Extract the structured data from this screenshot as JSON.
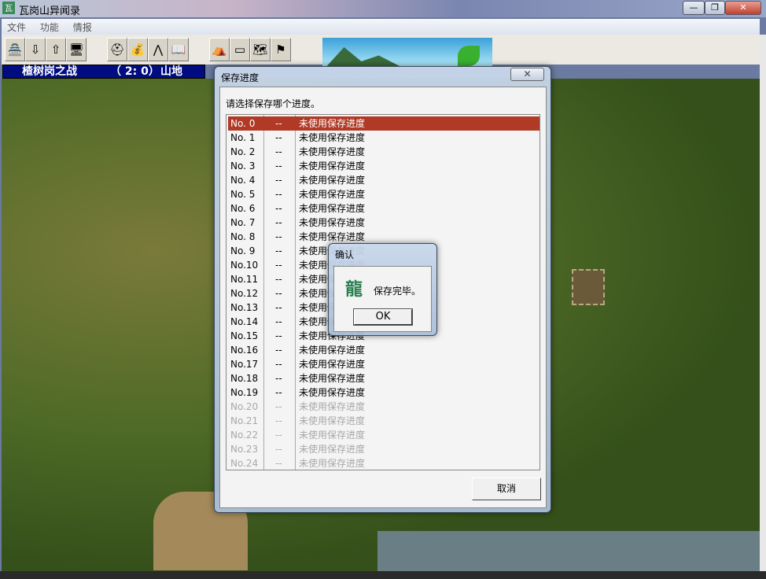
{
  "window": {
    "title": "瓦岗山异闻录",
    "minimize": "—",
    "restore": "❐",
    "close": "✕"
  },
  "menu": [
    "文件",
    "功能",
    "情报"
  ],
  "toolbar": [
    {
      "icon": "castle-icon",
      "glyph": "🏯"
    },
    {
      "icon": "load-icon",
      "glyph": "⇩"
    },
    {
      "icon": "save-icon",
      "glyph": "⇧"
    },
    {
      "icon": "computer-icon",
      "glyph": "🖥"
    },
    {
      "icon": "helmet-icon",
      "glyph": "⛑"
    },
    {
      "icon": "money-bag-icon",
      "glyph": "💰"
    },
    {
      "icon": "weapons-icon",
      "glyph": "⋀"
    },
    {
      "icon": "book-icon",
      "glyph": "📖"
    },
    {
      "icon": "tent-icon",
      "glyph": "⛺"
    },
    {
      "icon": "signboard-icon",
      "glyph": "▭"
    },
    {
      "icon": "map-icon",
      "glyph": "🗺"
    },
    {
      "icon": "flag-icon",
      "glyph": "⚑"
    }
  ],
  "status": {
    "battle": "楂树岗之战",
    "turn": "（ 2: 0）",
    "terrain": "山地"
  },
  "save_dialog": {
    "title": "保存进度",
    "close": "✕",
    "prompt": "请选择保存哪个进度。",
    "cancel": "取消",
    "slots": [
      {
        "no": "No. 0",
        "date": "--",
        "desc": "未使用保存进度"
      },
      {
        "no": "No. 1",
        "date": "--",
        "desc": "未使用保存进度"
      },
      {
        "no": "No. 2",
        "date": "--",
        "desc": "未使用保存进度"
      },
      {
        "no": "No. 3",
        "date": "--",
        "desc": "未使用保存进度"
      },
      {
        "no": "No. 4",
        "date": "--",
        "desc": "未使用保存进度"
      },
      {
        "no": "No. 5",
        "date": "--",
        "desc": "未使用保存进度"
      },
      {
        "no": "No. 6",
        "date": "--",
        "desc": "未使用保存进度"
      },
      {
        "no": "No. 7",
        "date": "--",
        "desc": "未使用保存进度"
      },
      {
        "no": "No. 8",
        "date": "--",
        "desc": "未使用保存进度"
      },
      {
        "no": "No. 9",
        "date": "--",
        "desc": "未使用保存进度"
      },
      {
        "no": "No.10",
        "date": "--",
        "desc": "未使用保存进度"
      },
      {
        "no": "No.11",
        "date": "--",
        "desc": "未使用保存进度"
      },
      {
        "no": "No.12",
        "date": "--",
        "desc": "未使用保存进度"
      },
      {
        "no": "No.13",
        "date": "--",
        "desc": "未使用保存进度"
      },
      {
        "no": "No.14",
        "date": "--",
        "desc": "未使用保存进度"
      },
      {
        "no": "No.15",
        "date": "--",
        "desc": "未使用保存进度"
      },
      {
        "no": "No.16",
        "date": "--",
        "desc": "未使用保存进度"
      },
      {
        "no": "No.17",
        "date": "--",
        "desc": "未使用保存进度"
      },
      {
        "no": "No.18",
        "date": "--",
        "desc": "未使用保存进度"
      },
      {
        "no": "No.19",
        "date": "--",
        "desc": "未使用保存进度"
      },
      {
        "no": "No.20",
        "date": "--",
        "desc": "未使用保存进度"
      },
      {
        "no": "No.21",
        "date": "--",
        "desc": "未使用保存进度"
      },
      {
        "no": "No.22",
        "date": "--",
        "desc": "未使用保存进度"
      },
      {
        "no": "No.23",
        "date": "--",
        "desc": "未使用保存进度"
      },
      {
        "no": "No.24",
        "date": "--",
        "desc": "未使用保存进度"
      }
    ],
    "selected_index": 0,
    "enabled_count": 20
  },
  "confirm_dialog": {
    "title": "确认",
    "message": "保存完毕。",
    "ok": "OK"
  },
  "colors": {
    "selection": "#b03a26",
    "status_bg": "#000c80"
  }
}
